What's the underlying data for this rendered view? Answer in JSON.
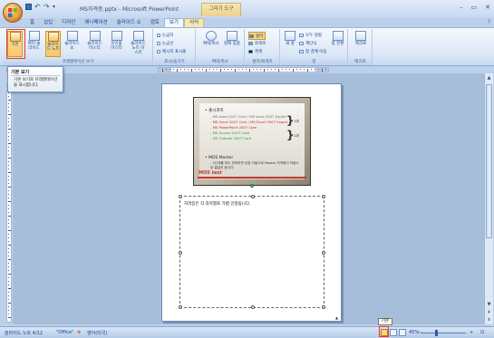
{
  "window": {
    "title": "MS자격증.pptx - Microsoft PowerPoint",
    "context_tab_title": "그리기 도구",
    "controls": [
      "–",
      "▭",
      "✕"
    ]
  },
  "tabs": [
    "홈",
    "삽입",
    "디자인",
    "애니메이션",
    "슬라이드 쇼",
    "검토",
    "보기",
    "서식"
  ],
  "active_tab": "보기",
  "ribbon": {
    "views": {
      "buttons": [
        "기본",
        "여러 슬라이드",
        "슬라이드 노트",
        "슬라이드 쇼",
        "슬라이드 마스터",
        "유인물 마스터",
        "슬라이드 노트 마스터"
      ],
      "label": "프레젠테이션 보기"
    },
    "show_hide": {
      "items": [
        "눈금자",
        "눈금선",
        "메시지 표시줄"
      ],
      "label": "표시/숨기기"
    },
    "zoom": {
      "buttons": [
        "확대/축소",
        "창에 맞춤"
      ],
      "label": "확대/축소"
    },
    "color": {
      "items": [
        "컬러",
        "회색조",
        "흑백"
      ],
      "label": "컬러/회색조"
    },
    "window": {
      "new_window": "새 창",
      "items": [
        "모두 정렬",
        "계단식",
        "창 경계 이동"
      ],
      "switch": "창 전환",
      "label": "창"
    },
    "macro": {
      "button": "매크로",
      "label": "매크로"
    }
  },
  "tooltip": {
    "title": "기본 보기",
    "description": "기본 보기로 프레젠테이션을 표시합니다."
  },
  "slide": {
    "heading": "• 출시과목",
    "lines": [
      "- MS word 2007 Core / MS word 2007 Expert",
      "- MS Excel 2007 Core / MS Excel 2007 Expert",
      "- MS PowerPoint 2007 Core",
      "- MS Access 2007 Core",
      "- MS Outlook 2007 Core"
    ],
    "brace_labels": [
      "1과",
      "1과"
    ],
    "sub_heading": "• MOS Master",
    "sub_text": "- 1단계를 모두 취득하면 상장 자동으로 Master 자격증이 자동으로 발급이 됩니다.",
    "logo": "MOS test"
  },
  "notes": {
    "text": "자격증은 각 과목별로 가볍 인정됩니다."
  },
  "view_tooltip": "기본",
  "status": {
    "slide_info": "슬라이드 노트 4/12",
    "theme": "\"Office\"",
    "language": "영어(미국)",
    "zoom": "45%"
  },
  "colors": {
    "accent": "#1e395b",
    "selected": "#f9c766",
    "workspace": "#a7bedb"
  }
}
